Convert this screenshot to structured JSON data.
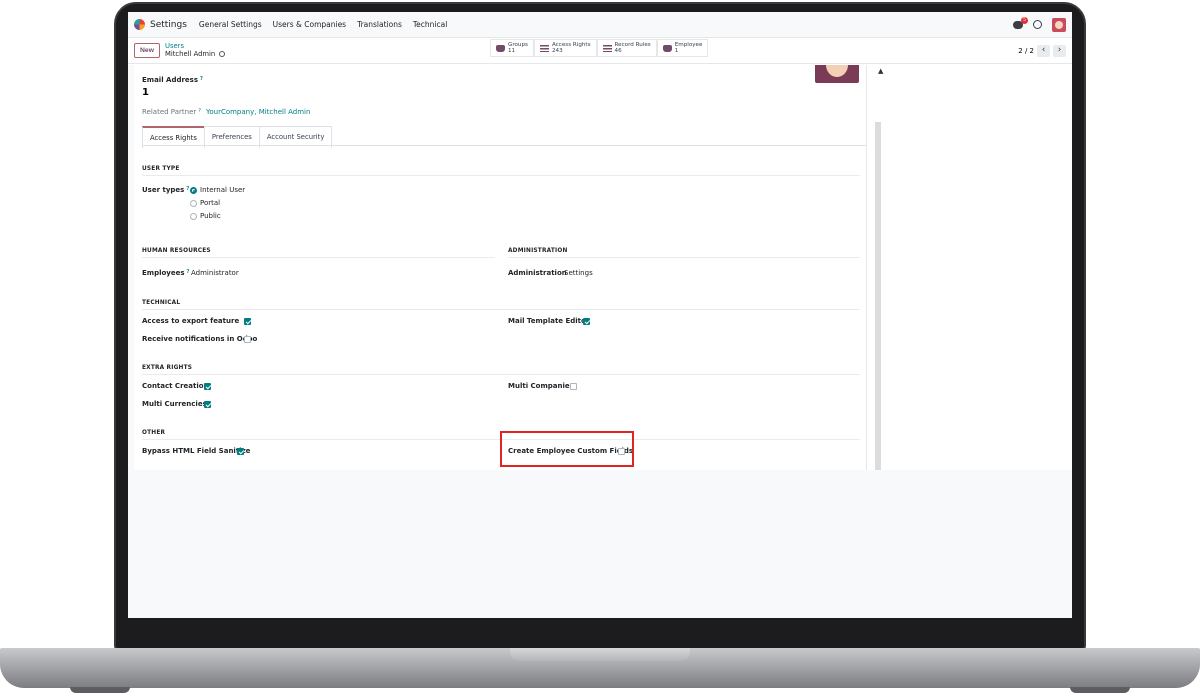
{
  "navbar": {
    "app_name": "Settings",
    "menu": [
      "General Settings",
      "Users & Companies",
      "Translations",
      "Technical"
    ],
    "chat_badge": "5"
  },
  "control": {
    "new_label": "New",
    "breadcrumb_parent": "Users",
    "breadcrumb_current": "Mitchell Admin",
    "smart_buttons": [
      {
        "label": "Groups",
        "value": "11"
      },
      {
        "label": "Access Rights",
        "value": "243"
      },
      {
        "label": "Record Rules",
        "value": "46"
      },
      {
        "label": "Employee",
        "value": "1"
      }
    ],
    "pager": "2 / 2"
  },
  "form": {
    "email_label": "Email Address",
    "email_value": "1",
    "partner_label": "Related Partner",
    "partner_value": "YourCompany, Mitchell Admin",
    "tabs": [
      "Access Rights",
      "Preferences",
      "Account Security"
    ],
    "user_type": {
      "section": "USER TYPE",
      "label": "User types",
      "options": [
        "Internal User",
        "Portal",
        "Public"
      ],
      "selected": "Internal User"
    },
    "hr": {
      "section": "HUMAN RESOURCES",
      "label": "Employees",
      "value": "Administrator"
    },
    "admin": {
      "section": "ADMINISTRATION",
      "label": "Administration",
      "value": "Settings"
    },
    "technical": {
      "section": "TECHNICAL",
      "export": "Access to export feature",
      "notifications": "Receive notifications in Odoo",
      "mail_template": "Mail Template Editor"
    },
    "extra": {
      "section": "EXTRA RIGHTS",
      "contact_creation": "Contact Creation",
      "multi_currencies": "Multi Currencies",
      "multi_companies": "Multi Companies"
    },
    "other": {
      "section": "OTHER",
      "bypass_html": "Bypass HTML Field Sanitize",
      "custom_fields": "Create Employee Custom Fields"
    }
  },
  "colors": {
    "accent": "#017e84",
    "brand": "#714b67",
    "highlight": "#e02424"
  }
}
